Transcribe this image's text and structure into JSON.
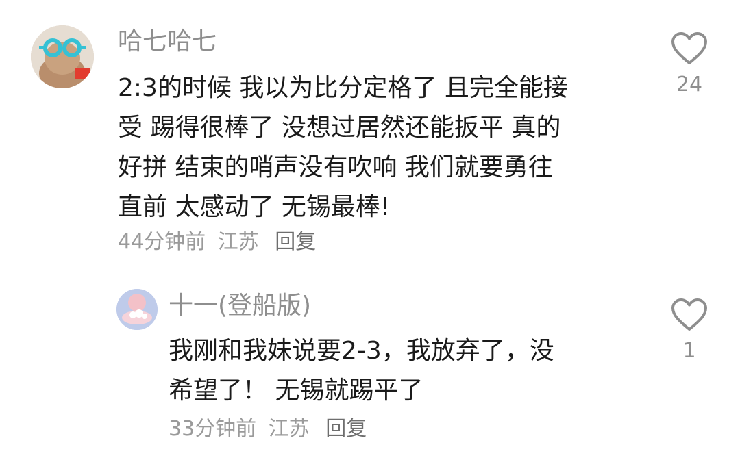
{
  "comments": [
    {
      "username": "哈七哈七",
      "text_lines": [
        "2:3的时候 我以为比分定格了 且完全能接",
        "受 踢得很棒了 没想过居然还能扳平 真的",
        "好拼 结束的哨声没有吹响 我们就要勇往",
        "直前 太感动了 无锡最棒!"
      ],
      "time": "44分钟前",
      "location": "江苏",
      "reply_label": "回复",
      "like_count": "24",
      "avatar_icon": "avatar-goggles-icon"
    },
    {
      "username": "十一(登船版)",
      "text_lines": [
        "我刚和我妹说要2-3，我放弃了，没",
        "希望了！ 无锡就踢平了"
      ],
      "time": "33分钟前",
      "location": "江苏",
      "reply_label": "回复",
      "like_count": "1",
      "avatar_icon": "avatar-cloud-icon"
    }
  ],
  "colors": {
    "username": "#8e8e8e",
    "body": "#1a1a1a",
    "meta": "#9a9a9a",
    "reply": "#6e6e6e",
    "heart": "#8e8e8e"
  },
  "icons": {
    "like": "heart-outline-icon"
  }
}
